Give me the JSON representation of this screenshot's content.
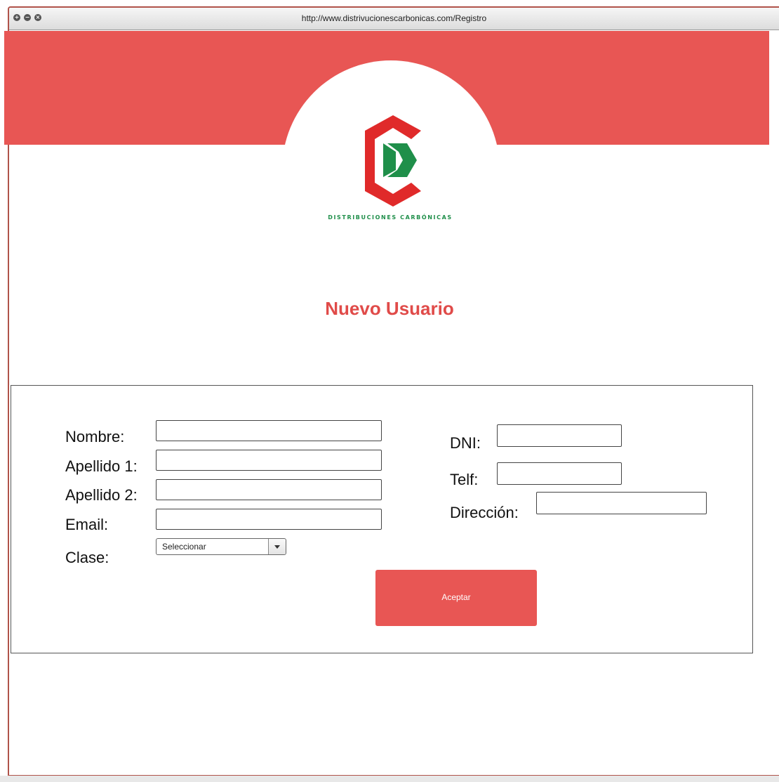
{
  "browser": {
    "url": "http://www.distrivucionescarbonicas.com/Registro"
  },
  "brand": {
    "name": "DISTRIBUCIONES CARBÓNICAS",
    "logo_icon": "cd-logo-icon",
    "accent_color": "#e85654",
    "green_color": "#1f8f4a"
  },
  "page": {
    "title": "Nuevo Usuario"
  },
  "form": {
    "labels": {
      "nombre": "Nombre:",
      "apellido1": "Apellido 1:",
      "apellido2": "Apellido 2:",
      "email": "Email:",
      "clase": "Clase:",
      "dni": "DNI:",
      "telf": "Telf:",
      "direccion": "Dirección:"
    },
    "values": {
      "nombre": "",
      "apellido1": "",
      "apellido2": "",
      "email": "",
      "dni": "",
      "telf": "",
      "direccion": ""
    },
    "clase_selected": "Seleccionar",
    "submit_label": "Aceptar"
  }
}
